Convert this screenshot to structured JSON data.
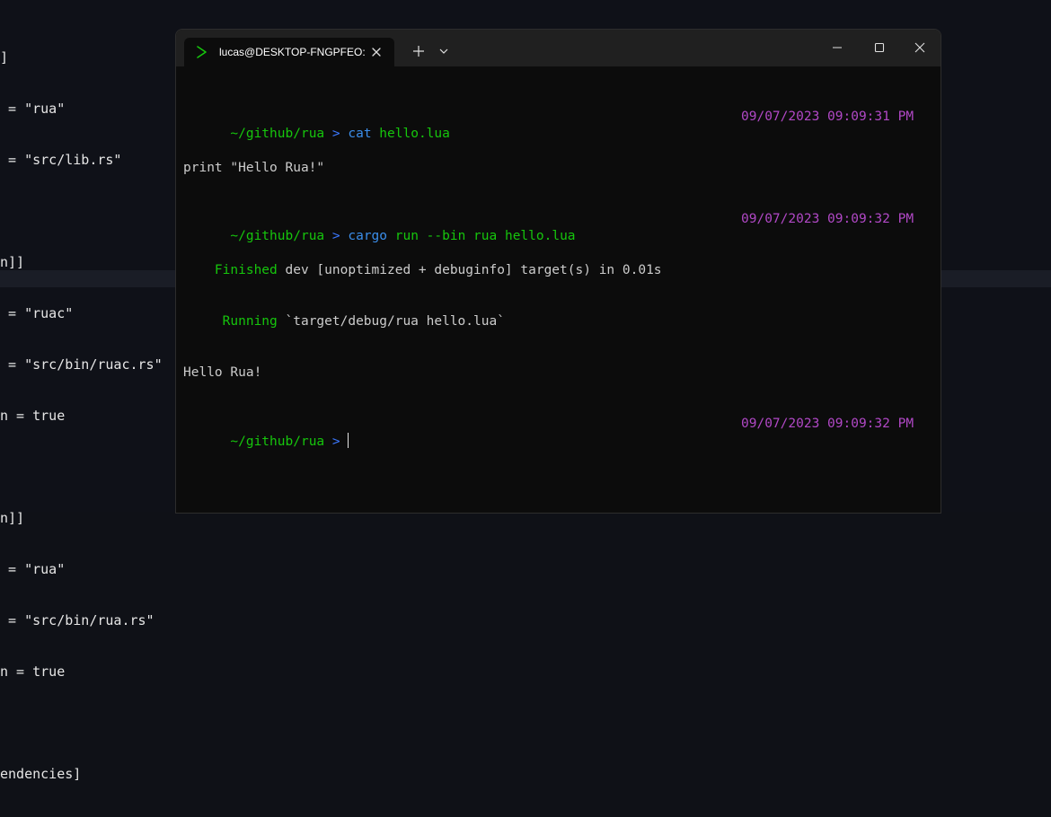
{
  "editor": {
    "lines": [
      "]",
      " = \"rua\"",
      " = \"src/lib.rs\"",
      "",
      "n]]",
      " = \"ruac\"",
      " = \"src/bin/ruac.rs\"",
      "n = true",
      "",
      "n]]",
      " = \"rua\"",
      " = \"src/bin/rua.rs\"",
      "n = true",
      "",
      "endencies]"
    ]
  },
  "terminal": {
    "tab_title": "lucas@DESKTOP-FNGPFEO: ~,",
    "icons": {
      "tab": "terminal-prompt-icon",
      "close": "close-icon",
      "new_tab": "plus-icon",
      "dropdown": "chevron-down-icon",
      "minimize": "minimize-icon",
      "maximize": "maximize-icon",
      "window_close": "close-icon"
    },
    "colors": {
      "path": "#16c60c",
      "arrow": "#3b78ff",
      "command": "#3b8eea",
      "argument": "#16c60c",
      "timestamp": "#b148c6",
      "text": "#cccccc",
      "background": "#0c0c0c"
    },
    "lines": {
      "l1": {
        "path": "~/github/rua",
        "arrow": ">",
        "cmd": "cat",
        "args": "hello.lua",
        "time": "09/07/2023 09:09:31 PM"
      },
      "l2": {
        "text": "print \"Hello Rua!\""
      },
      "l3": {
        "path": "~/github/rua",
        "arrow": ">",
        "cmd": "cargo",
        "args": "run --bin rua hello.lua",
        "time": "09/07/2023 09:09:32 PM"
      },
      "l4": {
        "status": "Finished",
        "text": "dev [unoptimized + debuginfo] target(s) in 0.01s"
      },
      "l5": {
        "status": "Running",
        "text": "`target/debug/rua hello.lua`"
      },
      "l6": {
        "text": "Hello Rua!"
      },
      "l7": {
        "path": "~/github/rua",
        "arrow": ">",
        "time": "09/07/2023 09:09:32 PM"
      }
    }
  }
}
